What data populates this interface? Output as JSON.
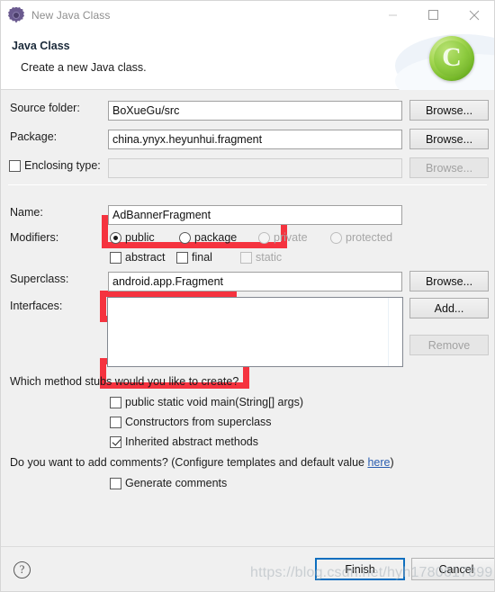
{
  "window": {
    "title": "New Java Class",
    "icon": "gear-icon",
    "controls": {
      "minimize": "minimize-icon",
      "maximize": "maximize-icon",
      "close": "close-icon"
    }
  },
  "header": {
    "title": "Java Class",
    "subtitle": "Create a new Java class.",
    "badge_letter": "C"
  },
  "form": {
    "source_folder": {
      "label": "Source folder:",
      "value": "BoXueGu/src",
      "button": "Browse..."
    },
    "package": {
      "label": "Package:",
      "value": "china.ynyx.heyunhui.fragment",
      "button": "Browse...",
      "highlighted": true
    },
    "enclosing_type": {
      "label": "Enclosing type:",
      "value": "",
      "checked": false,
      "button": "Browse...",
      "disabled": true
    },
    "name": {
      "label": "Name:",
      "value": "AdBannerFragment",
      "highlighted": true
    },
    "modifiers": {
      "label": "Modifiers:",
      "access": [
        {
          "label": "public",
          "selected": true,
          "disabled": false
        },
        {
          "label": "package",
          "selected": false,
          "disabled": false
        },
        {
          "label": "private",
          "selected": false,
          "disabled": true
        },
        {
          "label": "protected",
          "selected": false,
          "disabled": true
        }
      ],
      "flags": [
        {
          "label": "abstract",
          "checked": false,
          "disabled": false
        },
        {
          "label": "final",
          "checked": false,
          "disabled": false
        },
        {
          "label": "static",
          "checked": false,
          "disabled": true
        }
      ]
    },
    "superclass": {
      "label": "Superclass:",
      "value": "android.app.Fragment",
      "button": "Browse...",
      "highlighted": true
    },
    "interfaces": {
      "label": "Interfaces:",
      "items": [],
      "add_button": "Add...",
      "remove_button": "Remove",
      "remove_disabled": true
    }
  },
  "stubs": {
    "question": "Which method stubs would you like to create?",
    "options": [
      {
        "label": "public static void main(String[] args)",
        "checked": false
      },
      {
        "label": "Constructors from superclass",
        "checked": false
      },
      {
        "label": "Inherited abstract methods",
        "checked": true
      }
    ]
  },
  "comments": {
    "question_prefix": "Do you want to add comments? (Configure templates and default value ",
    "link": "here",
    "question_suffix": ")",
    "option": {
      "label": "Generate comments",
      "checked": false
    }
  },
  "footer": {
    "help": "?",
    "finish": "Finish",
    "cancel": "Cancel"
  },
  "watermark": "https://blog.csdn.net/hyh1780617899",
  "colors": {
    "annotation": "#f5333f",
    "accent": "#0d6ebf",
    "link": "#2a5db0",
    "badge_green": "#79bc2b",
    "window_bg": "#f0f0f0"
  }
}
